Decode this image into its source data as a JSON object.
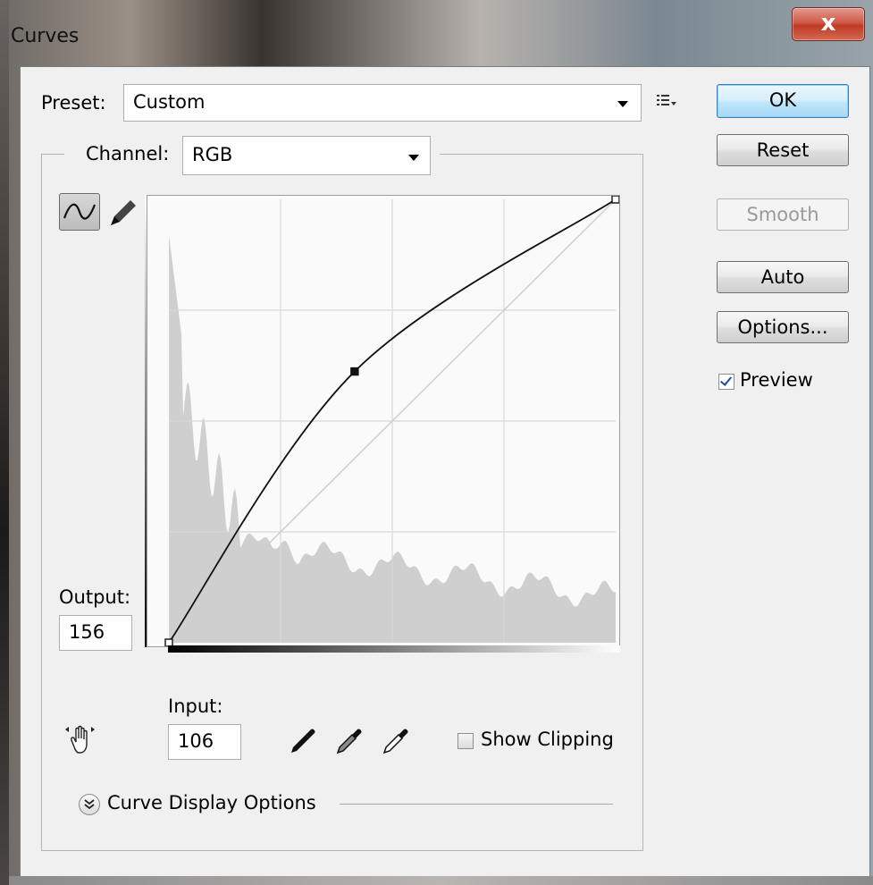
{
  "window": {
    "title": "Curves",
    "close_glyph": "x"
  },
  "preset": {
    "label": "Preset:",
    "value": "Custom",
    "menu_icon": "preset-options-icon"
  },
  "channel": {
    "label": "Channel:",
    "value": "RGB"
  },
  "buttons": {
    "ok": "OK",
    "reset": "Reset",
    "smooth": "Smooth",
    "auto": "Auto",
    "options": "Options..."
  },
  "preview": {
    "label": "Preview",
    "checked": true
  },
  "output": {
    "label": "Output:",
    "value": "156"
  },
  "input": {
    "label": "Input:",
    "value": "106"
  },
  "show_clipping": {
    "label": "Show Clipping",
    "checked": false
  },
  "curve_display": {
    "label": "Curve Display Options"
  },
  "tools": {
    "curve_tool": "curve-point-tool-icon",
    "pencil_tool": "pencil-tool-icon",
    "hand_tool": "on-image-adjust-hand-icon",
    "black_eyedropper": "black-point-eyedropper-icon",
    "gray_eyedropper": "gray-point-eyedropper-icon",
    "white_eyedropper": "white-point-eyedropper-icon"
  },
  "colors": {
    "default_button": "#3c7fb1",
    "close_button": "#c23a22",
    "histogram": "#cfcfcf"
  },
  "curve": {
    "domain": [
      0,
      255
    ],
    "points": [
      [
        0,
        0
      ],
      [
        106,
        156
      ],
      [
        255,
        255
      ]
    ]
  }
}
